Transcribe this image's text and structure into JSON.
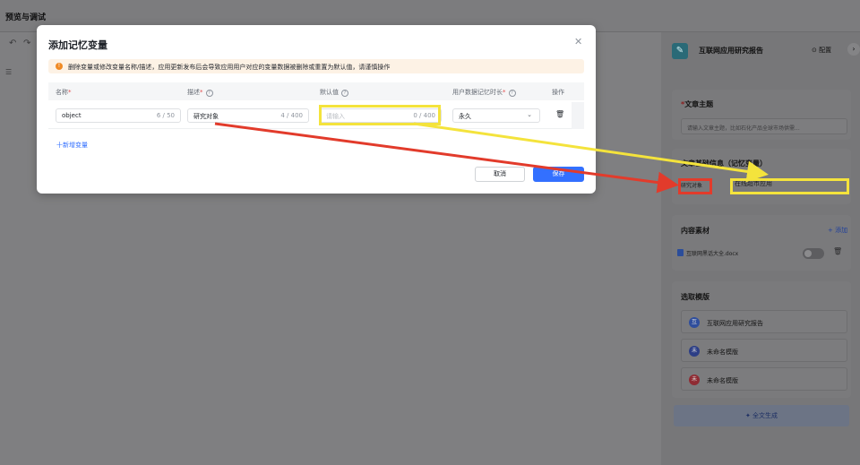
{
  "page": {
    "title": "预览与调试"
  },
  "toolbar": {
    "undo_icon": "undo-icon",
    "redo_icon": "redo-icon",
    "list_icon": "list-icon"
  },
  "right_panel": {
    "app_name": "互联网应用研究报告",
    "config_label": "⊙ 配置",
    "section_topic": {
      "title": "文章主题",
      "required_mark": "*",
      "placeholder": "请输入文章主题，比如石化产品全球市场供需..."
    },
    "section_basic_info": {
      "title": "文章基础信息（记忆变量）",
      "var_label": "研究对象",
      "var_value": "在线超市应用"
    },
    "section_materials": {
      "title": "内容素材",
      "add_label": "+ 添加",
      "file_name": "互联网黑话大全.docx"
    },
    "section_templates": {
      "title": "选取模版",
      "items": [
        {
          "badge": "互",
          "name": "互联网应用研究报告",
          "color": "#2f4e9d"
        },
        {
          "badge": "未",
          "name": "未命名模版",
          "color": "#2c3e86"
        },
        {
          "badge": "未",
          "name": "未命名模版",
          "color": "#8f2b33"
        }
      ]
    },
    "generate_label": "✦ 全文生成"
  },
  "modal": {
    "title": "添加记忆变量",
    "warning": "删除变量或修改变量名称/描述，应用更新发布后会导致应用用户对应的变量数据被删除或重置为默认值，请谨慎操作",
    "headers": {
      "name": "名称",
      "desc": "描述",
      "default": "默认值",
      "duration": "用户数据记忆时长",
      "action": "操作"
    },
    "row": {
      "name_value": "object",
      "name_count": "6 / 50",
      "desc_value": "研究对象",
      "desc_count": "4 / 400",
      "default_placeholder": "请输入",
      "default_count": "0 / 400",
      "duration_value": "永久"
    },
    "add_variable": "十新增变量",
    "cancel_label": "取消",
    "save_label": "保存"
  },
  "colors": {
    "primary": "#3370ff",
    "warning": "#f08a24",
    "highlight_yellow": "#f4e33c",
    "highlight_red": "#e23b2b"
  }
}
